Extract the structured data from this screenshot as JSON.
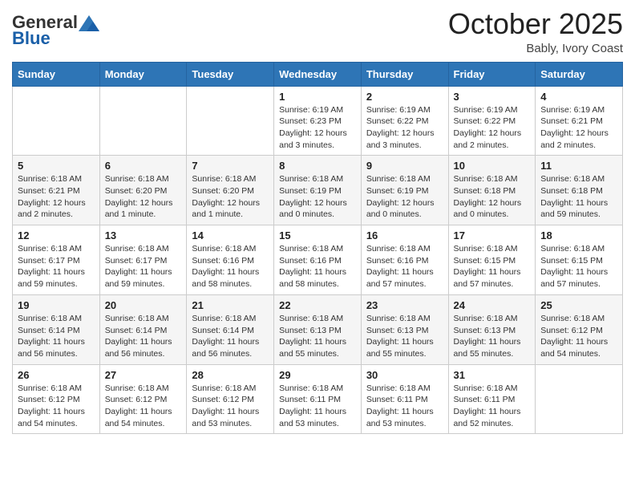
{
  "header": {
    "logo_general": "General",
    "logo_blue": "Blue",
    "month": "October 2025",
    "location": "Bably, Ivory Coast"
  },
  "days_of_week": [
    "Sunday",
    "Monday",
    "Tuesday",
    "Wednesday",
    "Thursday",
    "Friday",
    "Saturday"
  ],
  "weeks": [
    [
      {
        "day": "",
        "info": ""
      },
      {
        "day": "",
        "info": ""
      },
      {
        "day": "",
        "info": ""
      },
      {
        "day": "1",
        "info": "Sunrise: 6:19 AM\nSunset: 6:23 PM\nDaylight: 12 hours and 3 minutes."
      },
      {
        "day": "2",
        "info": "Sunrise: 6:19 AM\nSunset: 6:22 PM\nDaylight: 12 hours and 3 minutes."
      },
      {
        "day": "3",
        "info": "Sunrise: 6:19 AM\nSunset: 6:22 PM\nDaylight: 12 hours and 2 minutes."
      },
      {
        "day": "4",
        "info": "Sunrise: 6:19 AM\nSunset: 6:21 PM\nDaylight: 12 hours and 2 minutes."
      }
    ],
    [
      {
        "day": "5",
        "info": "Sunrise: 6:18 AM\nSunset: 6:21 PM\nDaylight: 12 hours and 2 minutes."
      },
      {
        "day": "6",
        "info": "Sunrise: 6:18 AM\nSunset: 6:20 PM\nDaylight: 12 hours and 1 minute."
      },
      {
        "day": "7",
        "info": "Sunrise: 6:18 AM\nSunset: 6:20 PM\nDaylight: 12 hours and 1 minute."
      },
      {
        "day": "8",
        "info": "Sunrise: 6:18 AM\nSunset: 6:19 PM\nDaylight: 12 hours and 0 minutes."
      },
      {
        "day": "9",
        "info": "Sunrise: 6:18 AM\nSunset: 6:19 PM\nDaylight: 12 hours and 0 minutes."
      },
      {
        "day": "10",
        "info": "Sunrise: 6:18 AM\nSunset: 6:18 PM\nDaylight: 12 hours and 0 minutes."
      },
      {
        "day": "11",
        "info": "Sunrise: 6:18 AM\nSunset: 6:18 PM\nDaylight: 11 hours and 59 minutes."
      }
    ],
    [
      {
        "day": "12",
        "info": "Sunrise: 6:18 AM\nSunset: 6:17 PM\nDaylight: 11 hours and 59 minutes."
      },
      {
        "day": "13",
        "info": "Sunrise: 6:18 AM\nSunset: 6:17 PM\nDaylight: 11 hours and 59 minutes."
      },
      {
        "day": "14",
        "info": "Sunrise: 6:18 AM\nSunset: 6:16 PM\nDaylight: 11 hours and 58 minutes."
      },
      {
        "day": "15",
        "info": "Sunrise: 6:18 AM\nSunset: 6:16 PM\nDaylight: 11 hours and 58 minutes."
      },
      {
        "day": "16",
        "info": "Sunrise: 6:18 AM\nSunset: 6:16 PM\nDaylight: 11 hours and 57 minutes."
      },
      {
        "day": "17",
        "info": "Sunrise: 6:18 AM\nSunset: 6:15 PM\nDaylight: 11 hours and 57 minutes."
      },
      {
        "day": "18",
        "info": "Sunrise: 6:18 AM\nSunset: 6:15 PM\nDaylight: 11 hours and 57 minutes."
      }
    ],
    [
      {
        "day": "19",
        "info": "Sunrise: 6:18 AM\nSunset: 6:14 PM\nDaylight: 11 hours and 56 minutes."
      },
      {
        "day": "20",
        "info": "Sunrise: 6:18 AM\nSunset: 6:14 PM\nDaylight: 11 hours and 56 minutes."
      },
      {
        "day": "21",
        "info": "Sunrise: 6:18 AM\nSunset: 6:14 PM\nDaylight: 11 hours and 56 minutes."
      },
      {
        "day": "22",
        "info": "Sunrise: 6:18 AM\nSunset: 6:13 PM\nDaylight: 11 hours and 55 minutes."
      },
      {
        "day": "23",
        "info": "Sunrise: 6:18 AM\nSunset: 6:13 PM\nDaylight: 11 hours and 55 minutes."
      },
      {
        "day": "24",
        "info": "Sunrise: 6:18 AM\nSunset: 6:13 PM\nDaylight: 11 hours and 55 minutes."
      },
      {
        "day": "25",
        "info": "Sunrise: 6:18 AM\nSunset: 6:12 PM\nDaylight: 11 hours and 54 minutes."
      }
    ],
    [
      {
        "day": "26",
        "info": "Sunrise: 6:18 AM\nSunset: 6:12 PM\nDaylight: 11 hours and 54 minutes."
      },
      {
        "day": "27",
        "info": "Sunrise: 6:18 AM\nSunset: 6:12 PM\nDaylight: 11 hours and 54 minutes."
      },
      {
        "day": "28",
        "info": "Sunrise: 6:18 AM\nSunset: 6:12 PM\nDaylight: 11 hours and 53 minutes."
      },
      {
        "day": "29",
        "info": "Sunrise: 6:18 AM\nSunset: 6:11 PM\nDaylight: 11 hours and 53 minutes."
      },
      {
        "day": "30",
        "info": "Sunrise: 6:18 AM\nSunset: 6:11 PM\nDaylight: 11 hours and 53 minutes."
      },
      {
        "day": "31",
        "info": "Sunrise: 6:18 AM\nSunset: 6:11 PM\nDaylight: 11 hours and 52 minutes."
      },
      {
        "day": "",
        "info": ""
      }
    ]
  ]
}
